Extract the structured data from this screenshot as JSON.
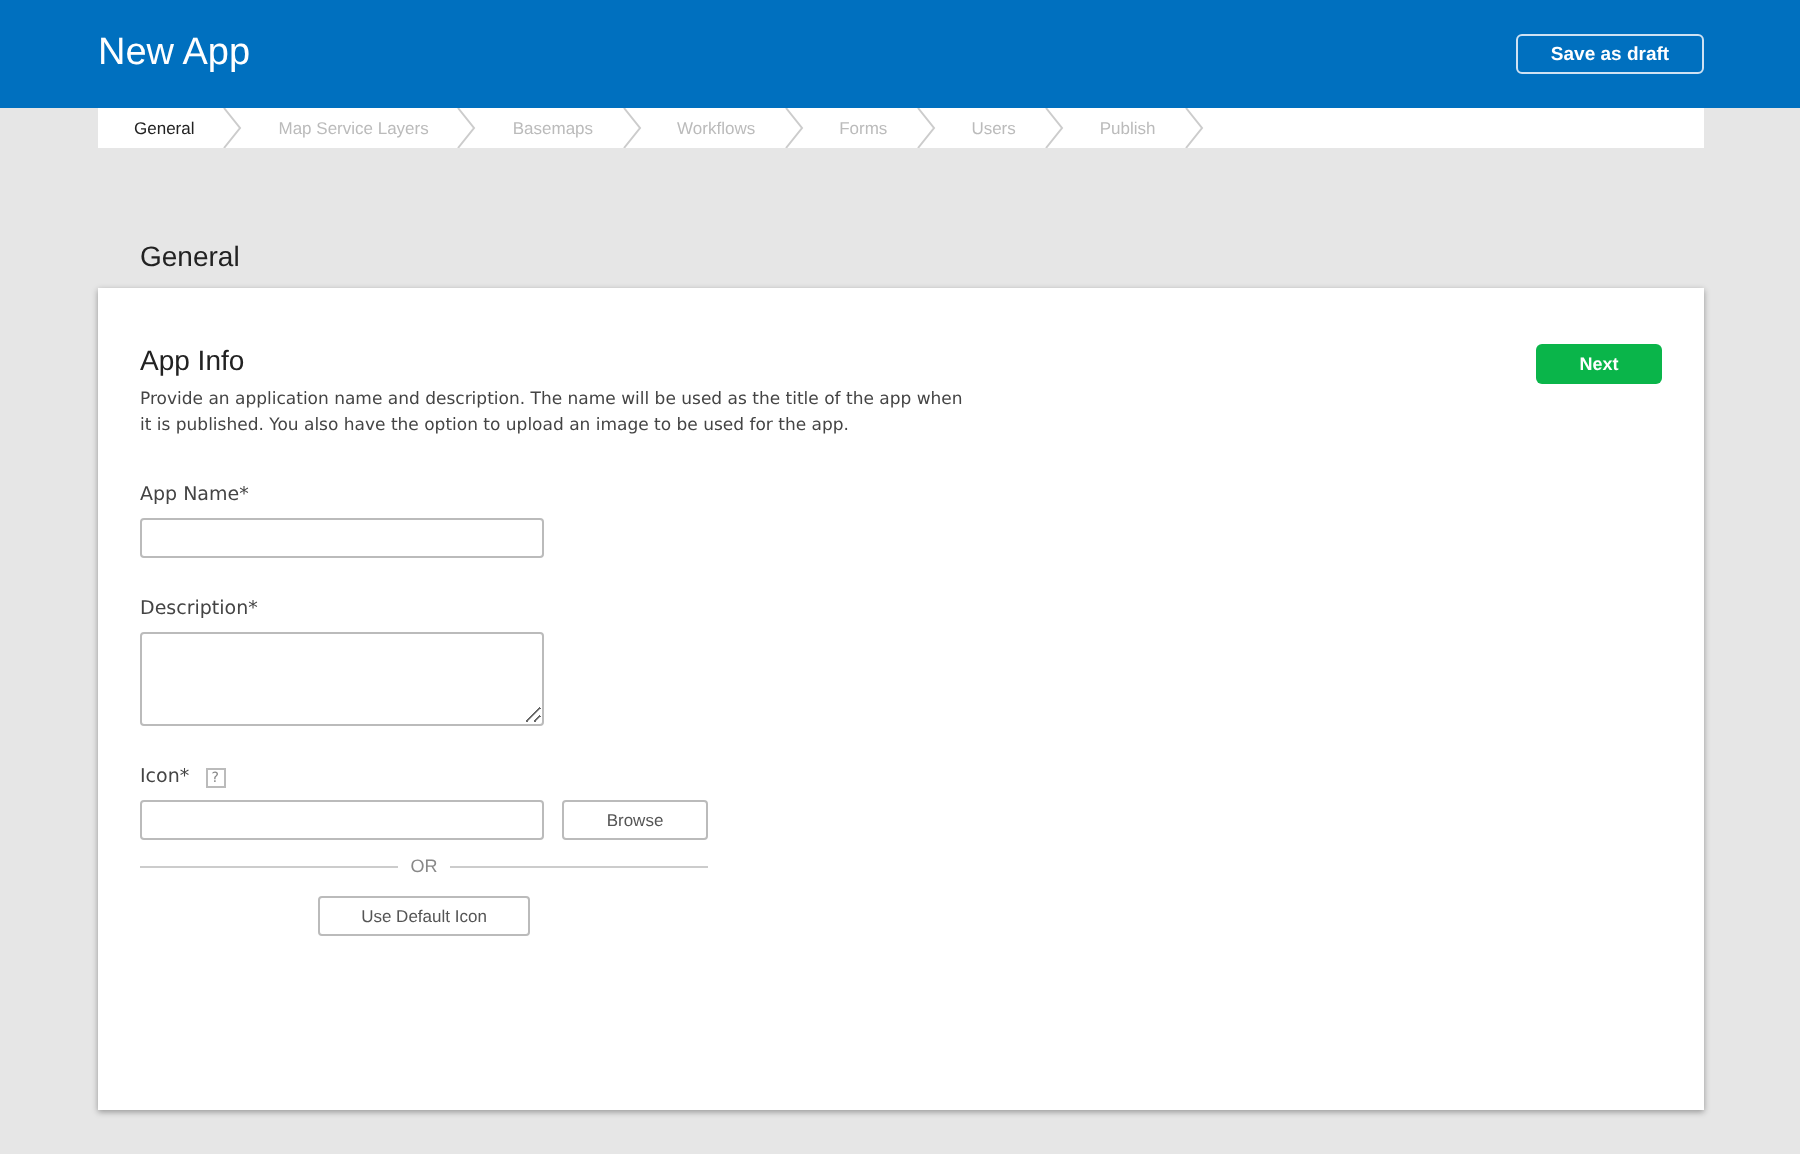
{
  "header": {
    "title": "New App",
    "save_button": "Save as draft"
  },
  "steps": [
    {
      "label": "General",
      "selected": true
    },
    {
      "label": "Map Service Layers",
      "selected": false
    },
    {
      "label": "Basemaps",
      "selected": false
    },
    {
      "label": "Workflows",
      "selected": false
    },
    {
      "label": "Forms",
      "selected": false
    },
    {
      "label": "Users",
      "selected": false
    },
    {
      "label": "Publish",
      "selected": false
    }
  ],
  "section_title": "General",
  "card": {
    "title": "App Info",
    "next_button": "Next",
    "description": "Provide an application name and description. The name will be used as the title of the app when it is published. You also have the option to upload an image to be used for the app.",
    "app_name_label": "App Name*",
    "description_label": "Description*",
    "icon_label": "Icon*",
    "help_mark": "?",
    "browse_button": "Browse",
    "or_text": "OR",
    "default_icon_button": "Use Default Icon"
  }
}
